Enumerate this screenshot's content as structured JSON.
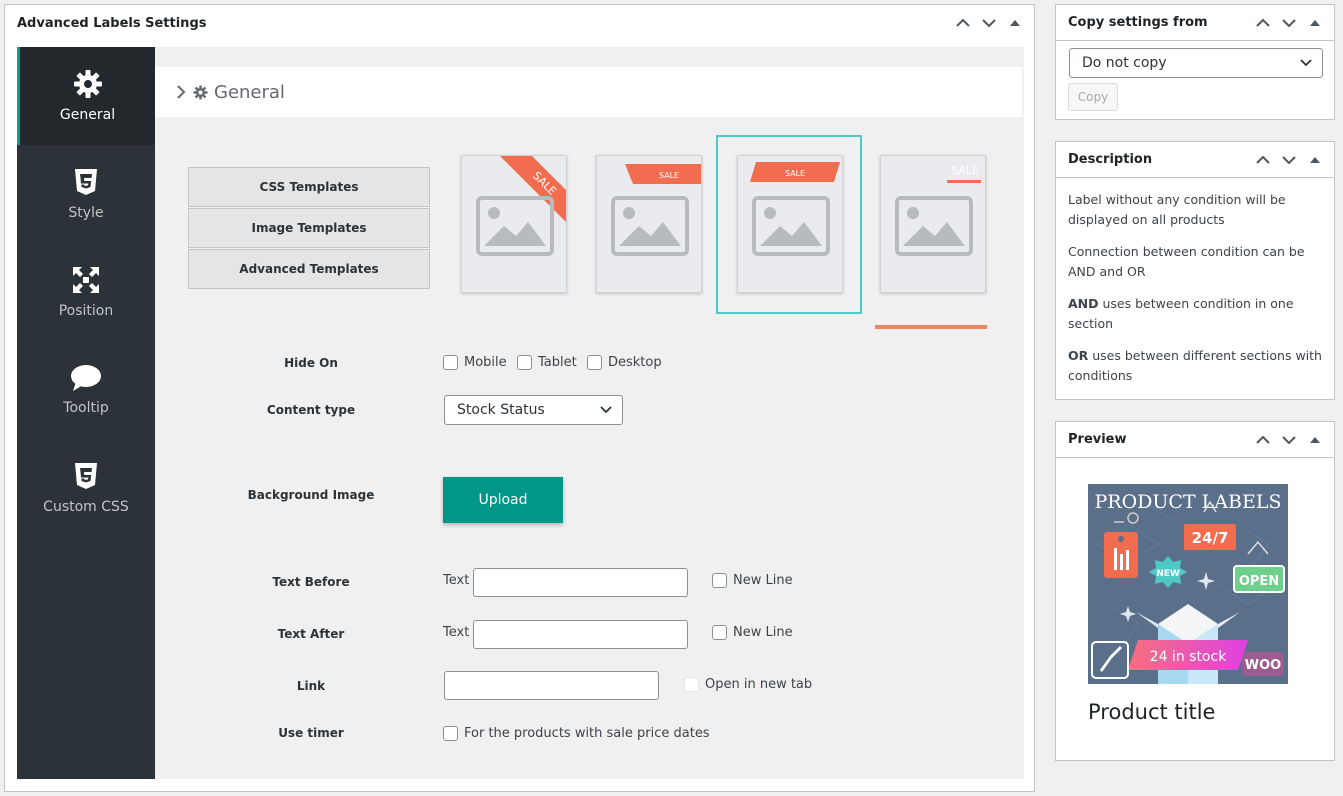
{
  "main_box": {
    "title": "Advanced Labels Settings"
  },
  "sidebar": {
    "items": [
      {
        "label": "General",
        "icon": "gear-icon"
      },
      {
        "label": "Style",
        "icon": "css3-icon"
      },
      {
        "label": "Position",
        "icon": "arrows-expand-icon"
      },
      {
        "label": "Tooltip",
        "icon": "speech-bubble-icon"
      },
      {
        "label": "Custom CSS",
        "icon": "css3-icon"
      }
    ]
  },
  "section": {
    "title": "General"
  },
  "templates": {
    "tabs": [
      "CSS Templates",
      "Image Templates",
      "Advanced Templates"
    ],
    "badge_text": "SALE",
    "selected_index": 2,
    "accent_color": "#f26c4f",
    "selection_color": "#4fc8c8"
  },
  "form": {
    "hide_on": {
      "label": "Hide On",
      "options": [
        "Mobile",
        "Tablet",
        "Desktop"
      ]
    },
    "content_type": {
      "label": "Content type",
      "value": "Stock Status"
    },
    "background_image": {
      "label": "Background Image",
      "button": "Upload"
    },
    "text_before": {
      "label": "Text Before",
      "prefix": "Text",
      "checkbox": "New Line"
    },
    "text_after": {
      "label": "Text After",
      "prefix": "Text",
      "checkbox": "New Line"
    },
    "link": {
      "label": "Link",
      "checkbox": "Open in new tab"
    },
    "use_timer": {
      "label": "Use timer",
      "checkbox": "For the products with sale price dates"
    }
  },
  "copy_box": {
    "title": "Copy settings from",
    "select_value": "Do not copy",
    "button": "Copy"
  },
  "description_box": {
    "title": "Description",
    "p1": "Label without any condition will be displayed on all products",
    "p2": "Connection between condition can be AND and OR",
    "p3_bold": "AND",
    "p3_rest": " uses between condition in one section",
    "p4_bold": "OR",
    "p4_rest": " uses between different sections with conditions"
  },
  "preview_box": {
    "title": "Preview",
    "image_heading": "PRODUCT LABELS",
    "badge_247": "24/7",
    "badge_new": "NEW",
    "badge_open": "OPEN",
    "stock_label": "24 in stock",
    "woo": "WOO",
    "product_title": "Product title"
  },
  "colors": {
    "teal": "#009688",
    "sidebar_bg": "#2c3338",
    "stock_gradient_start": "#f7717d",
    "stock_gradient_end": "#de3fe3"
  }
}
